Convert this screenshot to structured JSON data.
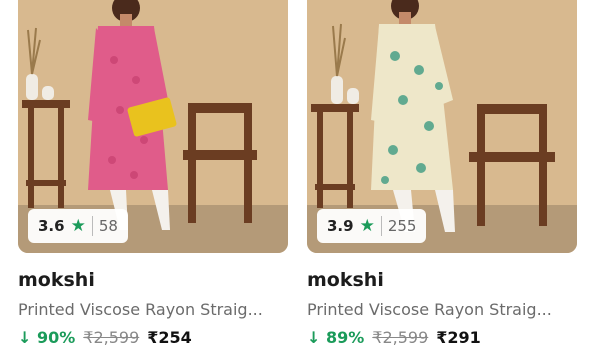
{
  "colors": {
    "rating_star": "#1b9b5a",
    "discount": "#1b9b5a",
    "brand": "#1c1c1c",
    "title": "#6b6b6b"
  },
  "icons": {
    "rating": "star-icon",
    "discount": "down-arrow-icon"
  },
  "products": [
    {
      "rating": "3.6",
      "star": "★",
      "rating_count": "58",
      "brand": "mokshi",
      "title": "Printed Viscose Rayon Straig...",
      "discount": "↓ 90%",
      "mrp": "₹2,599",
      "price": "₹254"
    },
    {
      "rating": "3.9",
      "star": "★",
      "rating_count": "255",
      "brand": "mokshi",
      "title": "Printed Viscose Rayon Straig...",
      "discount": "↓ 89%",
      "mrp": "₹2,599",
      "price": "₹291"
    }
  ]
}
